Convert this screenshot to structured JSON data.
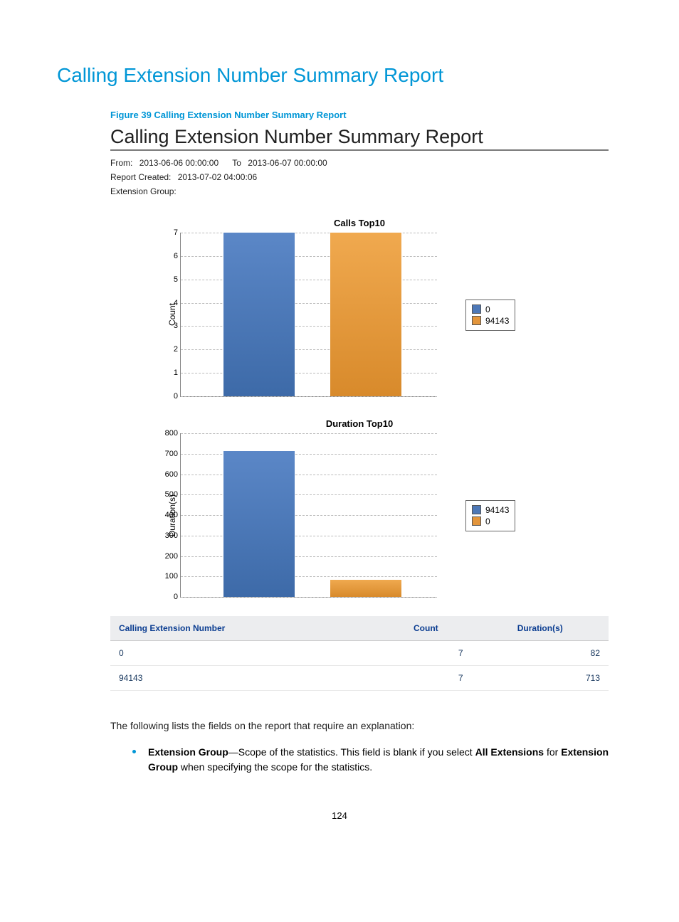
{
  "heading": "Calling Extension Number Summary Report",
  "figure_caption": "Figure 39 Calling Extension Number Summary Report",
  "report": {
    "title": "Calling Extension Number Summary Report",
    "from_label": "From:",
    "from_value": "2013-06-06 00:00:00",
    "to_label": "To",
    "to_value": "2013-06-07 00:00:00",
    "created_label": "Report Created:",
    "created_value": "2013-07-02 04:00:06",
    "ext_group_label": "Extension Group:",
    "ext_group_value": ""
  },
  "chart_data": [
    {
      "type": "bar",
      "title": "Calls Top10",
      "ylabel": "Count",
      "ylim": [
        0,
        7
      ],
      "ticks": [
        0,
        1,
        2,
        3,
        4,
        5,
        6,
        7
      ],
      "series": [
        {
          "name": "0",
          "value": 7,
          "color": "blue"
        },
        {
          "name": "94143",
          "value": 7,
          "color": "orange"
        }
      ],
      "legend_order": [
        "0",
        "94143"
      ]
    },
    {
      "type": "bar",
      "title": "Duration Top10",
      "ylabel": "Duration(s)",
      "ylim": [
        0,
        800
      ],
      "ticks": [
        0,
        100,
        200,
        300,
        400,
        500,
        600,
        700,
        800
      ],
      "series": [
        {
          "name": "94143",
          "value": 713,
          "color": "blue"
        },
        {
          "name": "0",
          "value": 82,
          "color": "orange"
        }
      ],
      "legend_order": [
        "94143",
        "0"
      ]
    }
  ],
  "table": {
    "headers": [
      "Calling Extension Number",
      "Count",
      "Duration(s)"
    ],
    "rows": [
      {
        "ext": "0",
        "count": "7",
        "dur": "82"
      },
      {
        "ext": "94143",
        "count": "7",
        "dur": "713"
      }
    ]
  },
  "explain_intro": "The following lists the fields on the report that require an explanation:",
  "explain_item_lead": "Extension Group",
  "explain_item_sep": "—",
  "explain_item_text_a": "Scope of the statistics. This field is blank if you select ",
  "explain_item_bold_a": "All Extensions",
  "explain_item_text_b": " for ",
  "explain_item_bold_b": "Extension Group",
  "explain_item_text_c": " when specifying the scope for the statistics.",
  "page_number": "124"
}
